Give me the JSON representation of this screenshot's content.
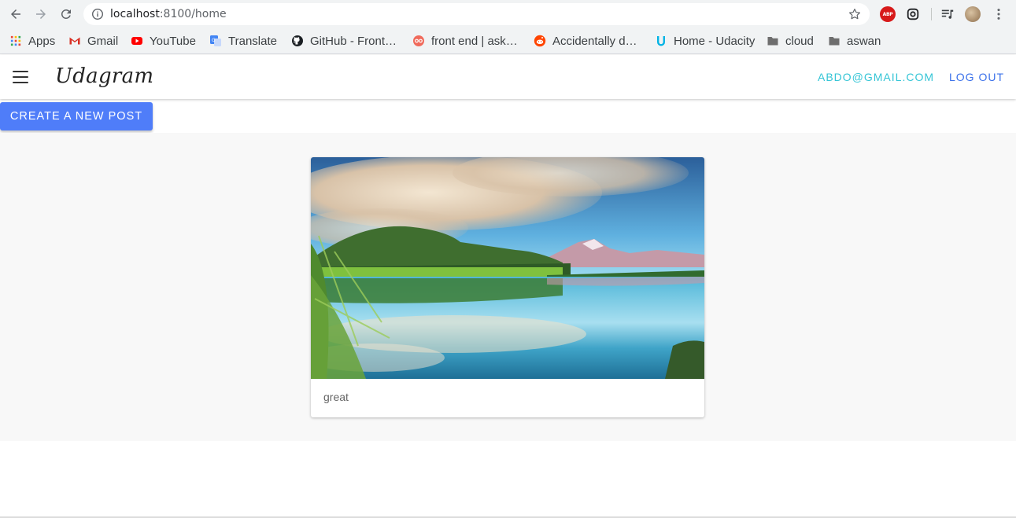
{
  "browser": {
    "url_host": "localhost",
    "url_rest": ":8100/home",
    "extensions": [
      "adblock-plus-icon",
      "screen-capture-icon",
      "media-playlist-icon",
      "profile-avatar",
      "kebab-menu-icon"
    ],
    "abp_label": "ABP"
  },
  "bookmarks": [
    {
      "label": "Apps",
      "icon": "apps-grid-icon"
    },
    {
      "label": "Gmail",
      "icon": "gmail-icon"
    },
    {
      "label": "YouTube",
      "icon": "youtube-icon"
    },
    {
      "label": "Translate",
      "icon": "translate-icon"
    },
    {
      "label": "GitHub - Front…",
      "icon": "github-icon"
    },
    {
      "label": "front end | ask…",
      "icon": "ask-icon"
    },
    {
      "label": "Accidentally d…",
      "icon": "reddit-icon"
    },
    {
      "label": "Home - Udacity",
      "icon": "udacity-icon"
    },
    {
      "label": "cloud",
      "icon": "folder-icon"
    },
    {
      "label": "aswan",
      "icon": "folder-icon"
    }
  ],
  "app": {
    "brand": "Udagram",
    "user_email": "ABDO@GMAIL.COM",
    "logout_label": "LOG OUT",
    "create_post_label": "CREATE A NEW POST"
  },
  "feed": {
    "posts": [
      {
        "caption": "great",
        "image": "lake-mountain-landscape"
      }
    ]
  },
  "colors": {
    "accent_button": "#4f7df9",
    "email_text": "#35c5d6",
    "logout_text": "#3b71ea"
  }
}
